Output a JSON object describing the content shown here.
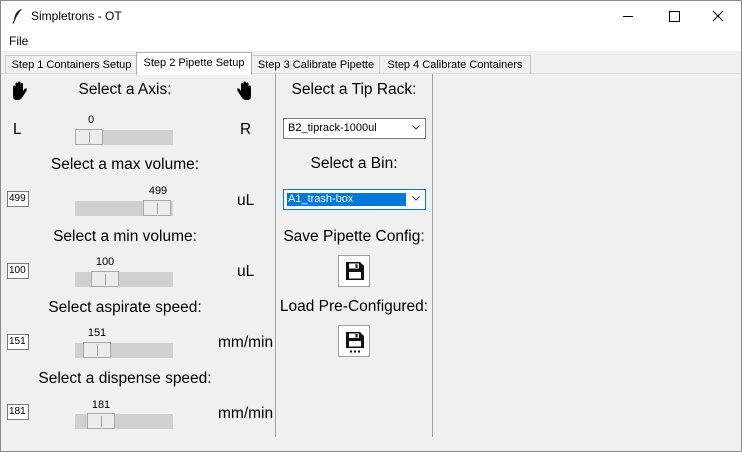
{
  "window": {
    "title": "Simpletrons - OT"
  },
  "menu": {
    "file": "File"
  },
  "tabs": [
    {
      "label": "Step 1 Containers Setup",
      "active": false
    },
    {
      "label": "Step 2 Pipette Setup",
      "active": true
    },
    {
      "label": "Step 3 Calibrate Pipette",
      "active": false
    },
    {
      "label": "Step 4 Calibrate Containers",
      "active": false
    }
  ],
  "axis": {
    "heading": "Select a Axis:",
    "left_label": "L",
    "right_label": "R",
    "value": "0",
    "fraction": 0.0
  },
  "max_volume": {
    "heading": "Select a max volume:",
    "value": "499",
    "slider_value": "499",
    "unit": "uL",
    "fraction": 1.0
  },
  "min_volume": {
    "heading": "Select a min volume:",
    "value": "100",
    "slider_value": "100",
    "unit": "uL",
    "fraction": 0.2
  },
  "aspirate_speed": {
    "heading": "Select aspirate speed:",
    "value": "151",
    "slider_value": "151",
    "unit": "mm/min",
    "fraction": 0.15
  },
  "dispense_speed": {
    "heading": "Select a dispense speed:",
    "value": "181",
    "slider_value": "181",
    "unit": "mm/min",
    "fraction": 0.2
  },
  "tip_rack": {
    "heading": "Select a Tip Rack:",
    "selected": "B2_tiprack-1000ul"
  },
  "bin": {
    "heading": "Select a Bin:",
    "selected": "A1_trash-box"
  },
  "save_config": {
    "heading": "Save Pipette Config:",
    "icon": "floppy-disk-icon"
  },
  "load_config": {
    "heading": "Load Pre-Configured:",
    "icon": "floppy-disk-load-icon"
  },
  "colors": {
    "selection": "#0078d7",
    "panel": "#f0f0f0",
    "track": "#d0d0d0"
  }
}
